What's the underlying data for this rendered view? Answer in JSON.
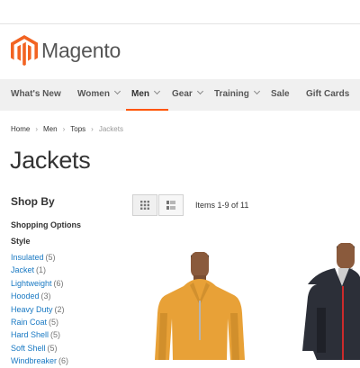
{
  "header": {
    "brand": "Magento"
  },
  "nav": {
    "items": [
      {
        "label": "What's New",
        "has_submenu": false,
        "active": false
      },
      {
        "label": "Women",
        "has_submenu": true,
        "active": false
      },
      {
        "label": "Men",
        "has_submenu": true,
        "active": true
      },
      {
        "label": "Gear",
        "has_submenu": true,
        "active": false
      },
      {
        "label": "Training",
        "has_submenu": true,
        "active": false
      },
      {
        "label": "Sale",
        "has_submenu": false,
        "active": false
      },
      {
        "label": "Gift Cards",
        "has_submenu": false,
        "active": false
      }
    ]
  },
  "breadcrumb": {
    "items": [
      {
        "label": "Home"
      },
      {
        "label": "Men"
      },
      {
        "label": "Tops"
      },
      {
        "label": "Jackets"
      }
    ]
  },
  "page": {
    "title": "Jackets"
  },
  "sidebar": {
    "heading": "Shop By",
    "subheading": "Shopping Options",
    "filter_group": "Style",
    "filters": [
      {
        "label": "Insulated",
        "count": "(5)"
      },
      {
        "label": "Jacket",
        "count": "(1)"
      },
      {
        "label": "Lightweight",
        "count": "(6)"
      },
      {
        "label": "Hooded",
        "count": "(3)"
      },
      {
        "label": "Heavy Duty",
        "count": "(2)"
      },
      {
        "label": "Rain Coat",
        "count": "(5)"
      },
      {
        "label": "Hard Shell",
        "count": "(5)"
      },
      {
        "label": "Soft Shell",
        "count": "(5)"
      },
      {
        "label": "Windbreaker",
        "count": "(6)"
      }
    ]
  },
  "toolbar": {
    "amount": "Items 1-9 of 11",
    "mode": "grid"
  },
  "colors": {
    "accent": "#ff5501",
    "link": "#1979c3",
    "nav_bg": "#f0f0f0",
    "logo": "#f26322"
  },
  "icons": {
    "logo": "magento-logo-icon",
    "grid": "grid-icon",
    "list": "list-icon",
    "nav_chevron": "chevron-down-icon"
  }
}
